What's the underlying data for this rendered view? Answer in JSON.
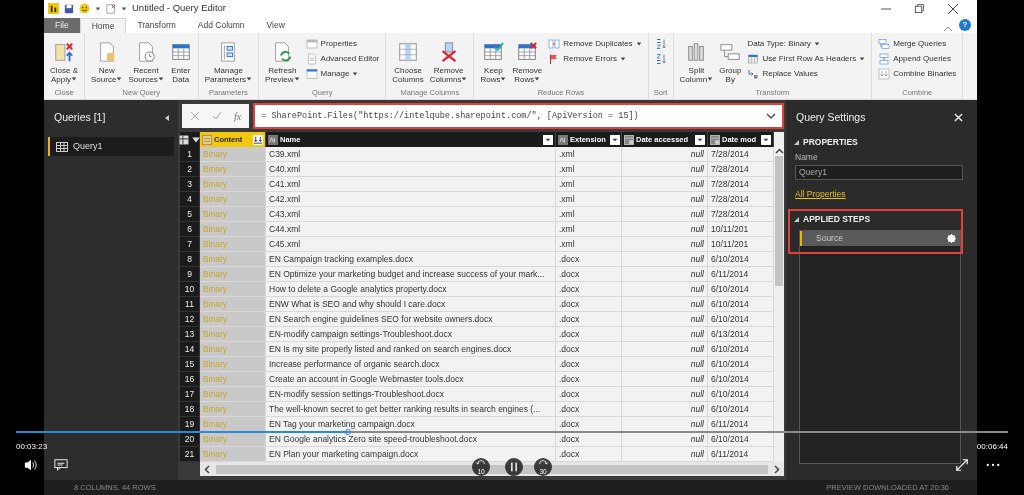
{
  "window": {
    "title": "Untitled - Query Editor",
    "help": "?"
  },
  "ribbon_tabs": [
    {
      "label": "File",
      "kind": "file",
      "selected": false
    },
    {
      "label": "Home",
      "kind": "tab",
      "selected": true
    },
    {
      "label": "Transform",
      "kind": "tab",
      "selected": false
    },
    {
      "label": "Add Column",
      "kind": "tab",
      "selected": false
    },
    {
      "label": "View",
      "kind": "tab",
      "selected": false
    }
  ],
  "ribbon_groups": [
    {
      "label": "Close",
      "items": [
        {
          "kind": "large",
          "lines": [
            "Close &",
            "Apply"
          ],
          "dropdown": true
        }
      ]
    },
    {
      "label": "New Query",
      "items": [
        {
          "kind": "large",
          "lines": [
            "New",
            "Source"
          ],
          "dropdown": true
        },
        {
          "kind": "large",
          "lines": [
            "Recent",
            "Sources"
          ],
          "dropdown": true
        },
        {
          "kind": "large",
          "lines": [
            "Enter",
            "Data"
          ],
          "dropdown": false
        }
      ]
    },
    {
      "label": "Parameters",
      "items": [
        {
          "kind": "large",
          "lines": [
            "Manage",
            "Parameters"
          ],
          "dropdown": true
        }
      ]
    },
    {
      "label": "Query",
      "items": [
        {
          "kind": "large",
          "lines": [
            "Refresh",
            "Preview"
          ],
          "dropdown": true
        },
        {
          "kind": "stack",
          "items": [
            {
              "kind": "small",
              "label": "Properties",
              "dropdown": false
            },
            {
              "kind": "small",
              "label": "Advanced Editor",
              "dropdown": false
            },
            {
              "kind": "small",
              "label": "Manage",
              "dropdown": true
            }
          ]
        }
      ]
    },
    {
      "label": "Manage Columns",
      "items": [
        {
          "kind": "large",
          "lines": [
            "Choose",
            "Columns"
          ],
          "dropdown": false
        },
        {
          "kind": "large",
          "lines": [
            "Remove",
            "Columns"
          ],
          "dropdown": true
        }
      ]
    },
    {
      "label": "Reduce Rows",
      "items": [
        {
          "kind": "large",
          "lines": [
            "Keep",
            "Rows"
          ],
          "dropdown": true
        },
        {
          "kind": "large",
          "lines": [
            "Remove",
            "Rows"
          ],
          "dropdown": true
        },
        {
          "kind": "stack",
          "items": [
            {
              "kind": "small",
              "label": "Remove Duplicates",
              "dropdown": true
            },
            {
              "kind": "small",
              "label": "Remove Errors",
              "dropdown": true
            }
          ]
        }
      ]
    },
    {
      "label": "Sort",
      "items": [
        {
          "kind": "stack",
          "items": [
            {
              "kind": "icon",
              "dropdown": false
            },
            {
              "kind": "icon",
              "dropdown": false
            }
          ]
        }
      ]
    },
    {
      "label": "Transform",
      "items": [
        {
          "kind": "large",
          "lines": [
            "Split",
            "Column"
          ],
          "dropdown": true
        },
        {
          "kind": "large",
          "lines": [
            "Group",
            "By"
          ],
          "dropdown": false
        },
        {
          "kind": "stack",
          "items": [
            {
              "kind": "text",
              "label": "Data Type: Binary",
              "dropdown": true
            },
            {
              "kind": "small",
              "label": "Use First Row As Headers",
              "dropdown": true
            },
            {
              "kind": "small",
              "label": "Replace Values",
              "dropdown": false
            }
          ]
        }
      ]
    },
    {
      "label": "Combine",
      "items": [
        {
          "kind": "stack",
          "items": [
            {
              "kind": "small",
              "label": "Merge Queries",
              "dropdown": false
            },
            {
              "kind": "small",
              "label": "Append Queries",
              "dropdown": false
            },
            {
              "kind": "small",
              "label": "Combine Binaries",
              "dropdown": false
            }
          ]
        }
      ]
    }
  ],
  "queries_pane": {
    "title": "Queries [1]",
    "queries": [
      {
        "label": "Query1",
        "selected": true
      }
    ]
  },
  "formula_bar": {
    "function_label": "fx",
    "formula": "= SharePoint.Files(\"https://intelqube.sharepoint.com/\", [ApiVersion = 15])",
    "highlighted": true
  },
  "columns": [
    {
      "label": "Content",
      "kind": "binary",
      "selected": true
    },
    {
      "label": "Name",
      "kind": "text",
      "selected": false
    },
    {
      "label": "Extension",
      "kind": "text",
      "selected": false
    },
    {
      "label": "Date accessed",
      "kind": "datetime",
      "selected": false
    },
    {
      "label": "Date mod",
      "kind": "datetime",
      "selected": false
    }
  ],
  "rows": [
    {
      "num": "1",
      "cells": [
        "Binary",
        "C39.xml",
        ".xml",
        "null",
        "7/28/2014"
      ]
    },
    {
      "num": "2",
      "cells": [
        "Binary",
        "C40.xml",
        ".xml",
        "null",
        "7/28/2014"
      ]
    },
    {
      "num": "3",
      "cells": [
        "Binary",
        "C41.xml",
        ".xml",
        "null",
        "7/28/2014"
      ]
    },
    {
      "num": "4",
      "cells": [
        "Binary",
        "C42.xml",
        ".xml",
        "null",
        "7/28/2014"
      ]
    },
    {
      "num": "5",
      "cells": [
        "Binary",
        "C43.xml",
        ".xml",
        "null",
        "7/28/2014"
      ]
    },
    {
      "num": "6",
      "cells": [
        "Binary",
        "C44.xml",
        ".xml",
        "null",
        "10/11/201"
      ]
    },
    {
      "num": "7",
      "cells": [
        "Binary",
        "C45.xml",
        ".xml",
        "null",
        "10/11/201"
      ]
    },
    {
      "num": "8",
      "cells": [
        "Binary",
        "EN Campaign tracking examples.docx",
        ".docx",
        "null",
        "6/10/2014"
      ]
    },
    {
      "num": "9",
      "cells": [
        "Binary",
        "EN Optimize your marketing budget and increase success of your mark...",
        ".docx",
        "null",
        "6/11/2014"
      ]
    },
    {
      "num": "10",
      "cells": [
        "Binary",
        "How to delete a Google analytics property.docx",
        ".docx",
        "null",
        "6/10/2014"
      ]
    },
    {
      "num": "11",
      "cells": [
        "Binary",
        "ENW What is SEO and why should I care.docx",
        ".docx",
        "null",
        "6/10/2014"
      ]
    },
    {
      "num": "12",
      "cells": [
        "Binary",
        "EN Search engine guidelines SEO for website owners.docx",
        ".docx",
        "null",
        "6/10/2014"
      ]
    },
    {
      "num": "13",
      "cells": [
        "Binary",
        "EN-modify campaign settings-Troubleshoot.docx",
        ".docx",
        "null",
        "6/13/2014"
      ]
    },
    {
      "num": "14",
      "cells": [
        "Binary",
        "EN Is my site properly listed and ranked on search engines.docx",
        ".docx",
        "null",
        "6/10/2014"
      ]
    },
    {
      "num": "15",
      "cells": [
        "Binary",
        "Increase performance of organic search.docx",
        ".docx",
        "null",
        "6/10/2014"
      ]
    },
    {
      "num": "16",
      "cells": [
        "Binary",
        "Create an account in Google Webmaster tools.docx",
        ".docx",
        "null",
        "6/10/2014"
      ]
    },
    {
      "num": "17",
      "cells": [
        "Binary",
        "EN-modify session settings-Troubleshoot.docx",
        ".docx",
        "null",
        "6/10/2014"
      ]
    },
    {
      "num": "18",
      "cells": [
        "Binary",
        "The well-known secret to get better ranking results in search engines (...",
        ".docx",
        "null",
        "6/10/2014"
      ]
    },
    {
      "num": "19",
      "cells": [
        "Binary",
        "EN Tag your marketing campaign.docx",
        ".docx",
        "null",
        "6/11/2014"
      ]
    },
    {
      "num": "20",
      "cells": [
        "Binary",
        "EN Google analytics Zero site speed-troubleshoot.docx",
        ".docx",
        "null",
        "6/10/2014"
      ]
    },
    {
      "num": "21",
      "cells": [
        "Binary",
        "EN Plan your marketing campaign.docx",
        ".docx",
        "null",
        "6/11/2014"
      ]
    }
  ],
  "query_settings": {
    "title": "Query Settings",
    "properties": {
      "heading": "PROPERTIES",
      "name_label": "Name",
      "name_value": "Query1",
      "link": "All Properties"
    },
    "applied_steps": {
      "heading": "APPLIED STEPS",
      "highlighted": true,
      "steps": [
        {
          "label": "Source",
          "selected": true
        }
      ]
    }
  },
  "status_bar": {
    "left": "8 COLUMNS, 44 ROWS",
    "right": "PREVIEW DOWNLOADED AT 20:36"
  },
  "video": {
    "elapsed": "00:03:23",
    "duration": "00:06:44",
    "level": 0.335,
    "playing": true,
    "skip_back": "10",
    "skip_forward": "30"
  }
}
